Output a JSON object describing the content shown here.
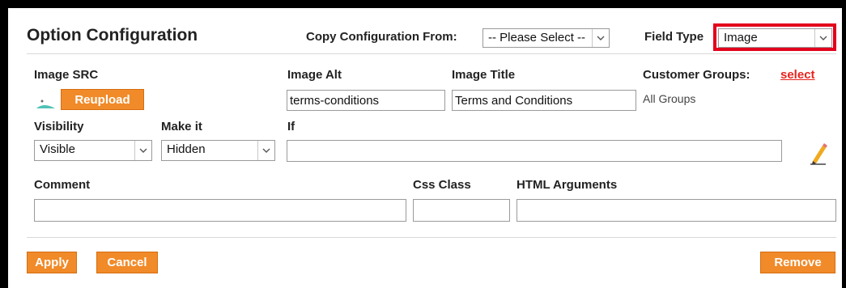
{
  "panel": {
    "title": "Option Configuration"
  },
  "copy_config": {
    "label": "Copy Configuration From:",
    "selected": "-- Please Select --"
  },
  "field_type": {
    "label": "Field Type",
    "selected": "Image",
    "highlight_color": "#e3001b"
  },
  "image": {
    "src_label": "Image SRC",
    "reupload_label": "Reupload",
    "alt_label": "Image Alt",
    "alt_value": "terms-conditions",
    "title_label": "Image Title",
    "title_value": "Terms and Conditions"
  },
  "customer_groups": {
    "label": "Customer Groups:",
    "select_link": "select",
    "value": "All Groups"
  },
  "visibility": {
    "label": "Visibility",
    "selected": "Visible"
  },
  "make_it": {
    "label": "Make it",
    "selected": "Hidden"
  },
  "condition": {
    "label": "If",
    "value": ""
  },
  "comment": {
    "label": "Comment",
    "value": ""
  },
  "css_class": {
    "label": "Css Class",
    "value": ""
  },
  "html_args": {
    "label": "HTML Arguments",
    "value": ""
  },
  "actions": {
    "apply": "Apply",
    "cancel": "Cancel",
    "remove": "Remove"
  },
  "colors": {
    "button": "#f18a28",
    "link": "#e8231d"
  }
}
